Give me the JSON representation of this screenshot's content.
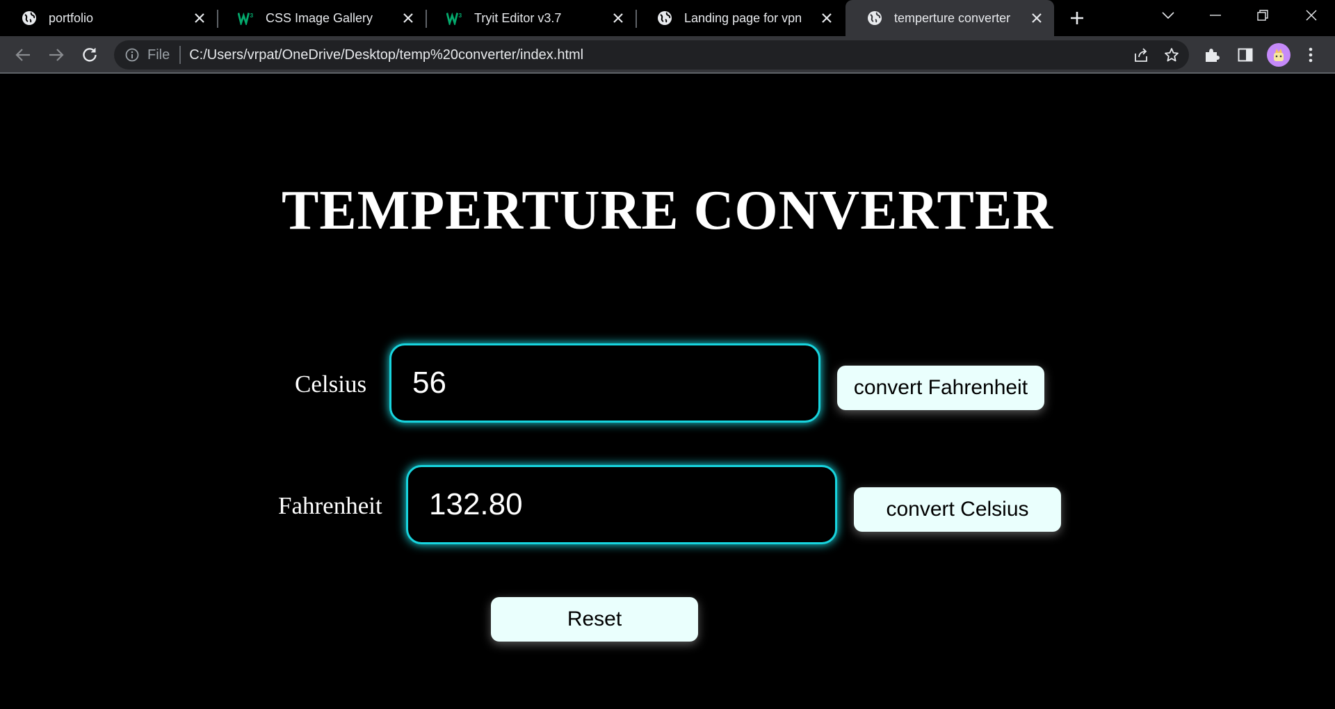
{
  "browser": {
    "tabs": [
      {
        "title": "portfolio",
        "icon": "globe-icon"
      },
      {
        "title": "CSS Image Gallery",
        "icon": "w3schools-icon"
      },
      {
        "title": "Tryit Editor v3.7",
        "icon": "w3schools-icon"
      },
      {
        "title": "Landing page for vpn",
        "icon": "globe-icon"
      },
      {
        "title": "temperture converter",
        "icon": "globe-icon"
      }
    ],
    "address_scheme": "File",
    "address_url": "C:/Users/vrpat/OneDrive/Desktop/temp%20converter/index.html",
    "colors": {
      "tab_active": "#35363a",
      "w3_green": "#04aa6d",
      "avatar": "#c58af9"
    }
  },
  "page": {
    "title": "TEMPERTURE CONVERTER",
    "celsius_label": "Celsius",
    "celsius_value": "56",
    "convert_fahrenheit_label": "convert Fahrenheit",
    "fahrenheit_label": "Fahrenheit",
    "fahrenheit_value": "132.80",
    "convert_celsius_label": "convert Celsius",
    "reset_label": "Reset",
    "colors": {
      "background": "#000000",
      "field_border": "#17d4de",
      "button_bg": "#eafffd"
    }
  }
}
